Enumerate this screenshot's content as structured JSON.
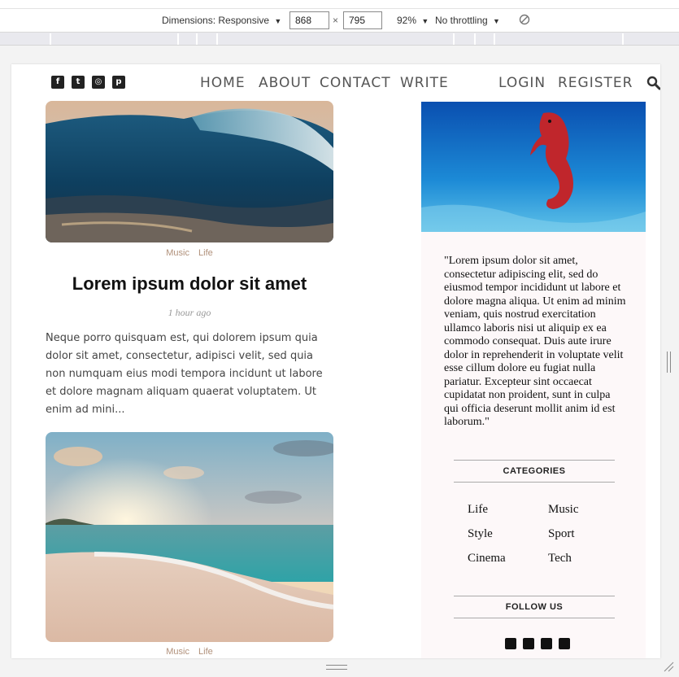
{
  "devtools": {
    "dimensions_label": "Dimensions: Responsive",
    "width_value": "868",
    "height_value": "795",
    "times": "×",
    "zoom": "92%",
    "throttling": "No throttling",
    "dropdown_caret": "▼"
  },
  "nav": {
    "social_icons": [
      "facebook-icon",
      "twitter-icon",
      "instagram-icon",
      "pinterest-icon"
    ],
    "items": [
      "HOME",
      "ABOUT",
      "CONTACT",
      "WRITE"
    ],
    "auth": [
      "LOGIN",
      "REGISTER"
    ]
  },
  "posts": [
    {
      "categories": [
        "Music",
        "Life"
      ],
      "title": "Lorem ipsum dolor sit amet",
      "date": "1 hour ago",
      "desc": "Neque porro quisquam est, qui dolorem ipsum quia dolor sit amet, consectetur, adipisci velit, sed quia non numquam eius modi tempora incidunt ut labore et dolore magnam aliquam quaerat voluptatem. Ut enim ad mini..."
    },
    {
      "categories": [
        "Music",
        "Life"
      ]
    }
  ],
  "sidebar": {
    "about_text": "\"Lorem ipsum dolor sit amet, consectetur adipiscing elit, sed do eiusmod tempor incididunt ut labore et dolore magna aliqua. Ut enim ad minim veniam, quis nostrud exercitation ullamco laboris nisi ut aliquip ex ea commodo consequat. Duis aute irure dolor in reprehenderit in voluptate velit esse cillum dolore eu fugiat nulla pariatur. Excepteur sint occaecat cupidatat non proident, sunt in culpa qui officia deserunt mollit anim id est laborum.\"",
    "categories_title": "CATEGORIES",
    "categories": [
      "Life",
      "Music",
      "Style",
      "Sport",
      "Cinema",
      "Tech"
    ],
    "follow_title": "FOLLOW US"
  },
  "colors": {
    "accent_category": "#b0907a",
    "sidebar_bg": "#fdf8f9"
  }
}
